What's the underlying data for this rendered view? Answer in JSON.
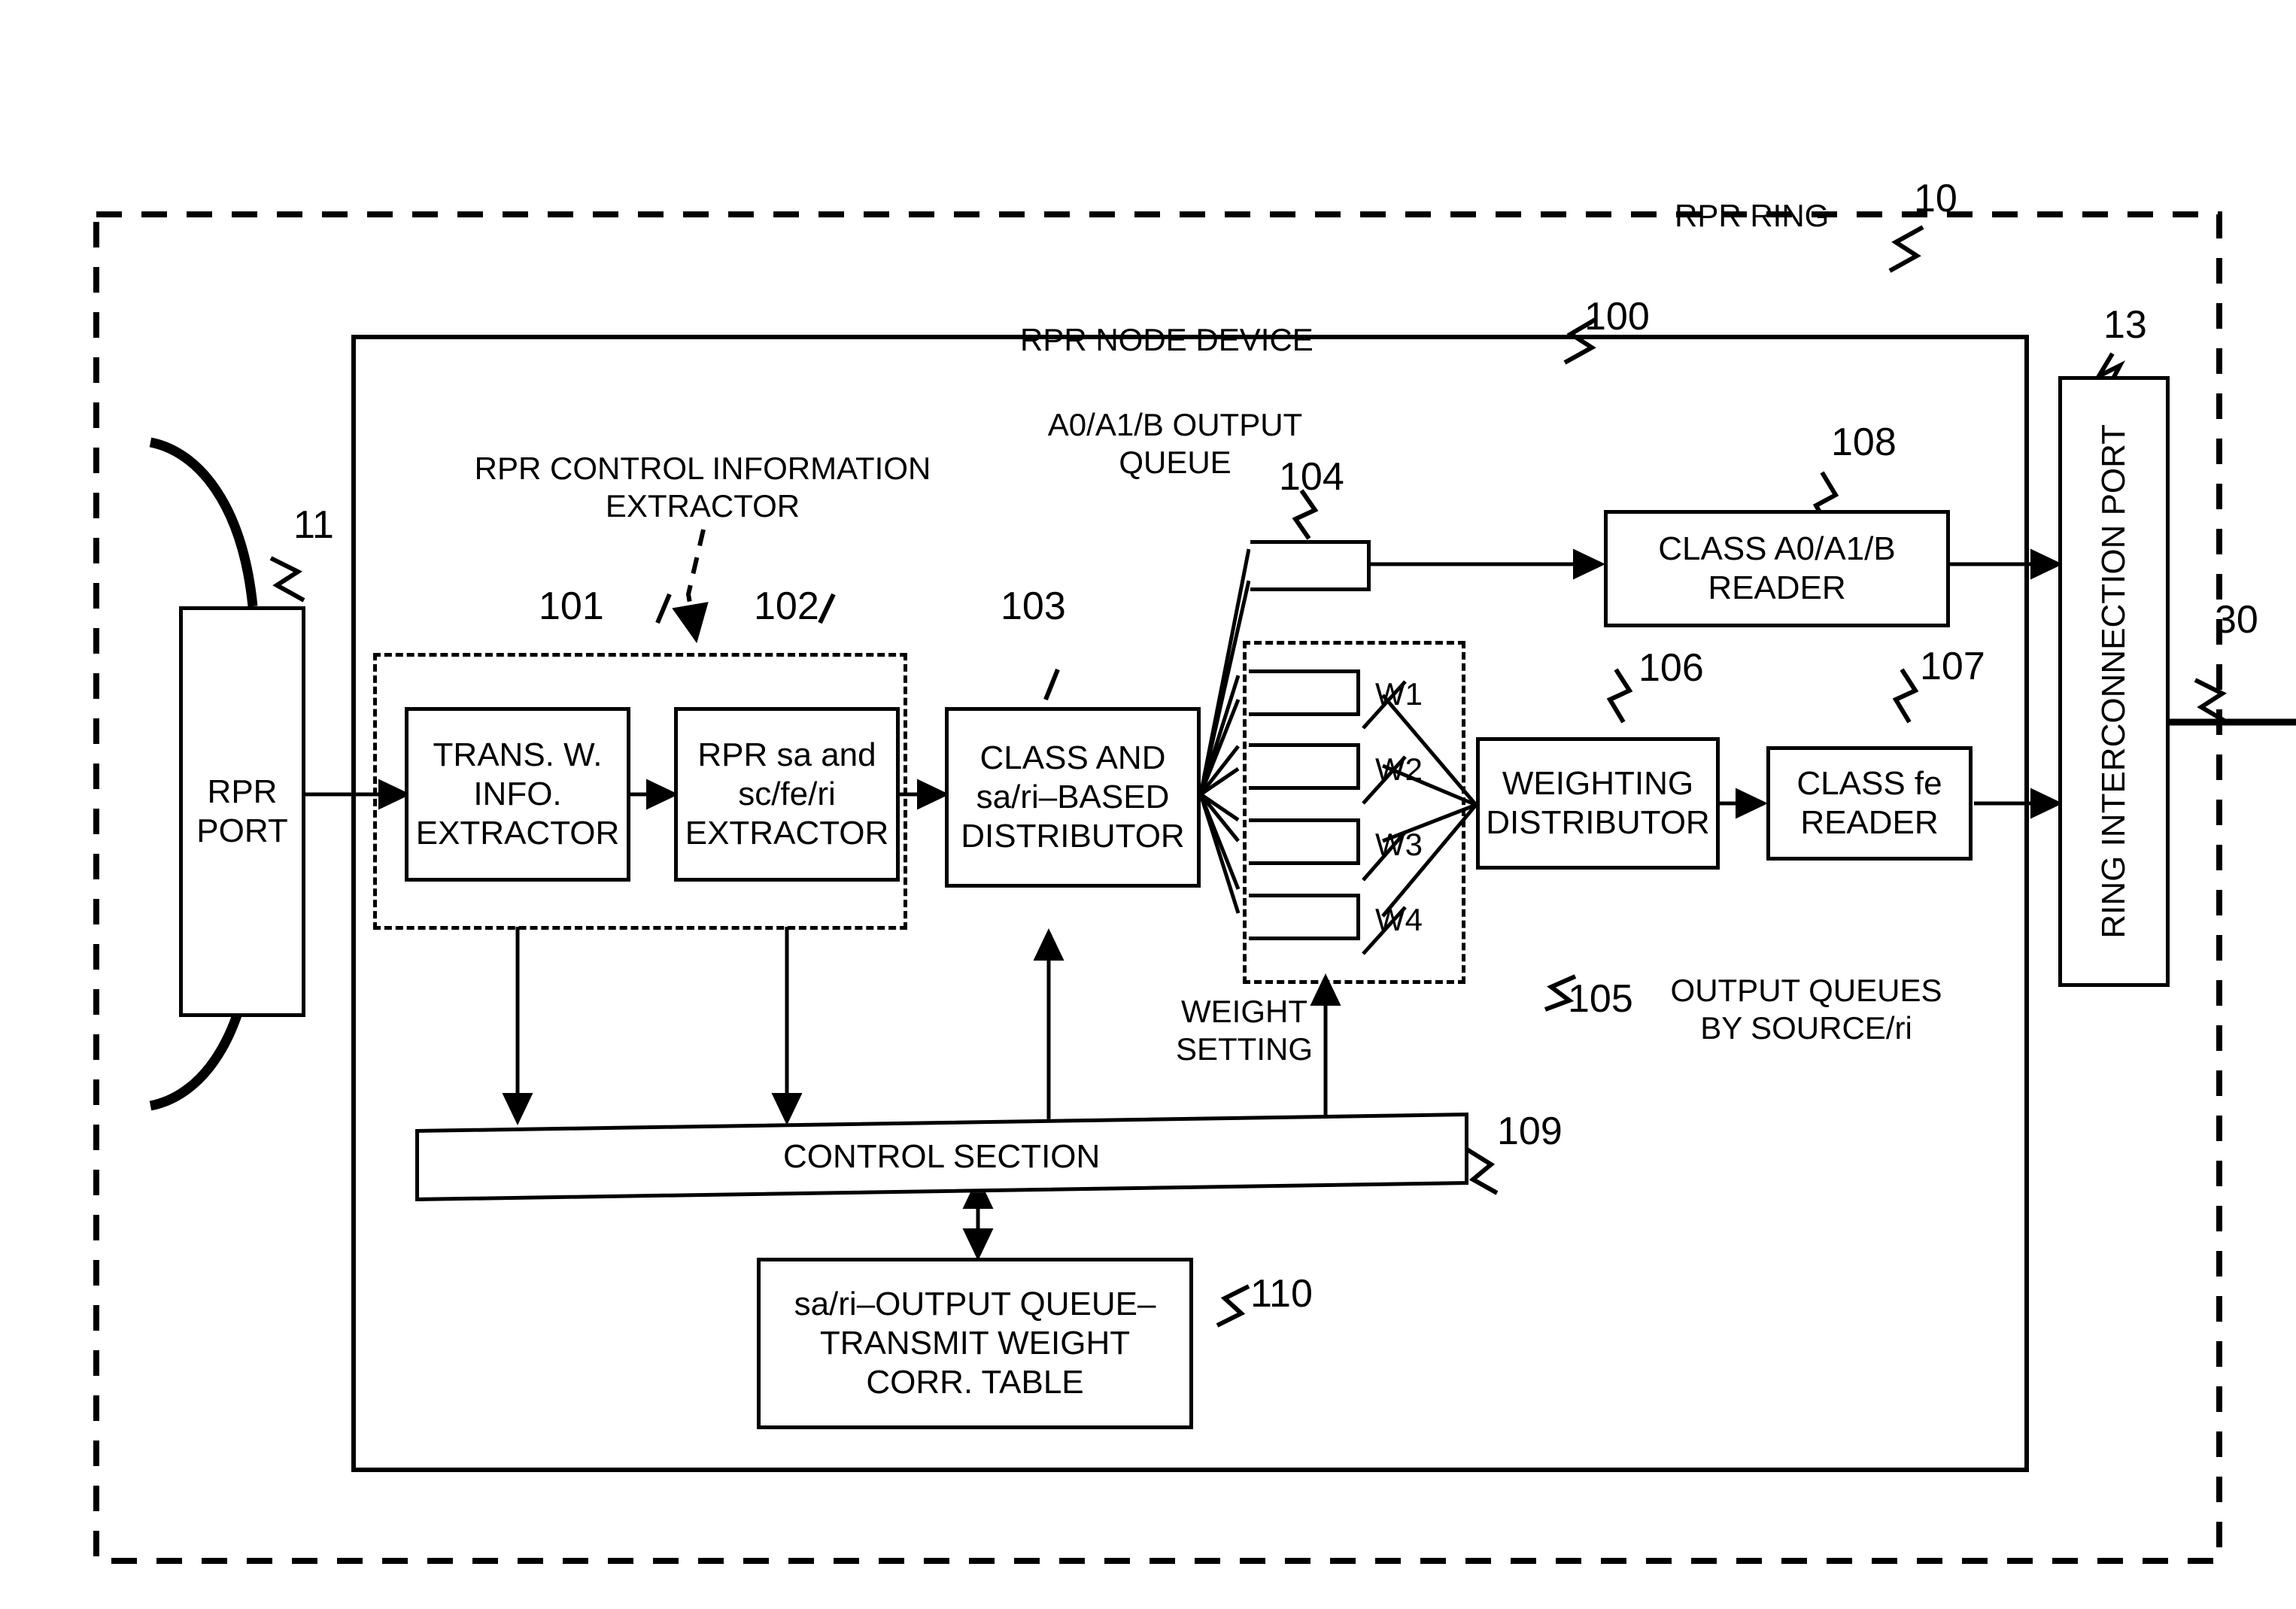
{
  "figure": {
    "outer_label": "RPR RING",
    "outer_ref": "10",
    "inner_label": "RPR NODE DEVICE",
    "inner_ref": "100"
  },
  "ports": {
    "rpr_port": "RPR\nPORT",
    "rpr_port_ref": "11",
    "ring_interconnection_port": "RING INTERCONNECTION PORT",
    "ring_interconnection_port_ref": "13",
    "external_link_ref": "30"
  },
  "extractor_group": {
    "label": "RPR CONTROL INFORMATION\nEXTRACTOR",
    "blocks": [
      {
        "ref": "101",
        "label": "TRANS. W.\nINFO.\nEXTRACTOR"
      },
      {
        "ref": "102",
        "label": "RPR sa and\nsc/fe/ri\nEXTRACTOR"
      }
    ]
  },
  "blocks": {
    "distributor": {
      "ref": "103",
      "label": "CLASS AND\nsa/ri–BASED\nDISTRIBUTOR"
    },
    "ao_queue": {
      "ref": "104",
      "label": "A0/A1/B OUTPUT\nQUEUE"
    },
    "source_queues": {
      "ref": "105",
      "label": "OUTPUT QUEUES\nBY SOURCE/ri"
    },
    "weighting": {
      "ref": "106",
      "label": "WEIGHTING\nDISTRIBUTOR"
    },
    "class_fe_reader": {
      "ref": "107",
      "label": "CLASS fe\nREADER"
    },
    "class_a_reader": {
      "ref": "108",
      "label": "CLASS A0/A1/B\nREADER"
    },
    "control_section": {
      "ref": "109",
      "label": "CONTROL SECTION"
    },
    "corr_table": {
      "ref": "110",
      "label": "sa/ri–OUTPUT QUEUE–\nTRANSMIT WEIGHT\nCORR. TABLE"
    }
  },
  "queue_weights": [
    "W1",
    "W2",
    "W3",
    "W4"
  ],
  "annotations": {
    "weight_setting": "WEIGHT\nSETTING"
  },
  "colors": {
    "ink": "#000000",
    "paper": "#ffffff"
  }
}
